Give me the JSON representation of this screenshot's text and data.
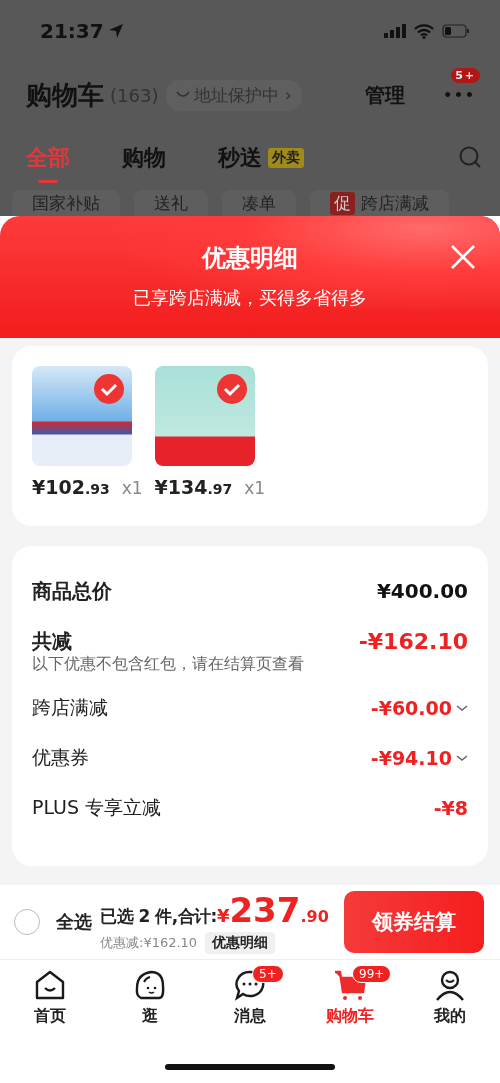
{
  "status_bar": {
    "time": "21:37"
  },
  "header": {
    "title": "购物车",
    "count": "(163)",
    "address": "地址保护中 ›",
    "manage": "管理",
    "more": "•••",
    "more_badge": "5+"
  },
  "tabs": [
    {
      "label": "全部",
      "selected": true
    },
    {
      "label": "购物",
      "selected": false
    },
    {
      "label": "秒送",
      "tag": "外卖",
      "selected": false
    }
  ],
  "chips": [
    {
      "label": "国家补贴"
    },
    {
      "label": "送礼"
    },
    {
      "label": "凑单"
    },
    {
      "tag": "促",
      "label": "跨店满减"
    }
  ],
  "sheet": {
    "title": "优惠明细",
    "subtitle": "已享跨店满减，买得多省得多",
    "products": [
      {
        "kind": "skincare",
        "price": "¥102",
        "decimal": ".93",
        "qty": "x1",
        "selected": true
      },
      {
        "kind": "sneaker",
        "price": "¥134",
        "decimal": ".97",
        "qty": "x1",
        "selected": true
      }
    ],
    "summary": [
      {
        "kind": "total",
        "label": "商品总价",
        "value": "¥400.00"
      },
      {
        "kind": "discount",
        "label": "共减",
        "value": "-¥162.10",
        "note": "以下优惠不包含红包，请在结算页查看"
      },
      {
        "kind": "line",
        "label": "跨店满减",
        "value": "-¥60.00",
        "expandable": true
      },
      {
        "kind": "line",
        "label": "优惠券",
        "value": "-¥94.10",
        "expandable": true
      },
      {
        "kind": "line",
        "label": "PLUS 专享立减",
        "value": "-¥8",
        "expandable": false
      }
    ]
  },
  "checkout": {
    "select_all": {
      "label": "全选",
      "checked": false
    },
    "selected_text": "已选 2 件,合计:",
    "currency": "¥",
    "amount": "237",
    "decimal": ".90",
    "discount": "优惠减:¥162.10",
    "details_button": "优惠明细",
    "checkout_button": "领券结算"
  },
  "bottom_nav": [
    {
      "kind": "home",
      "label": "首页",
      "selected": false
    },
    {
      "kind": "explore",
      "label": "逛",
      "selected": false
    },
    {
      "kind": "message",
      "label": "消息",
      "badge": "5+",
      "selected": false
    },
    {
      "kind": "cart",
      "label": "购物车",
      "badge": "99+",
      "selected": true
    },
    {
      "kind": "profile",
      "label": "我的",
      "selected": false
    }
  ]
}
